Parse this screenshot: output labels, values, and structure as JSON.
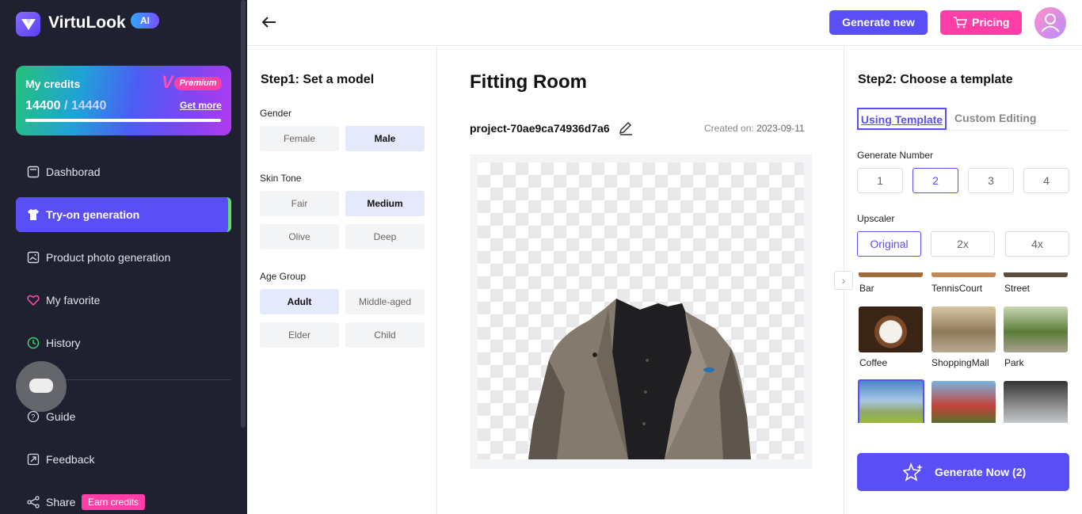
{
  "app": {
    "name": "VirtuLook",
    "badge": "AI"
  },
  "credits": {
    "title": "My credits",
    "used": "14400",
    "separator": " / ",
    "total": "14440",
    "get_more": "Get more",
    "premium": "Premium",
    "bar_fraction": 1.0
  },
  "nav": [
    {
      "label": "Dashborad",
      "icon": "dashboard-icon"
    },
    {
      "label": "Try-on generation",
      "icon": "shirt-icon",
      "active": true
    },
    {
      "label": "Product photo generation",
      "icon": "photo-icon"
    },
    {
      "label": "My favorite",
      "icon": "heart-icon"
    },
    {
      "label": "History",
      "icon": "clock-icon"
    },
    {
      "label": "Guide",
      "icon": "help-icon"
    },
    {
      "label": "Feedback",
      "icon": "feedback-icon"
    },
    {
      "label": "Share",
      "icon": "share-icon"
    }
  ],
  "share_badge": "Earn credits",
  "header": {
    "generate_new": "Generate new",
    "pricing": "Pricing"
  },
  "step1": {
    "title": "Step1: Set a model",
    "gender": {
      "label": "Gender",
      "options": [
        "Female",
        "Male"
      ],
      "selected": "Male"
    },
    "skin": {
      "label": "Skin Tone",
      "options": [
        "Fair",
        "Medium",
        "Olive",
        "Deep"
      ],
      "selected": "Medium"
    },
    "age": {
      "label": "Age Group",
      "options": [
        "Adult",
        "Middle-aged",
        "Elder",
        "Child"
      ],
      "selected": "Adult"
    }
  },
  "fitting": {
    "title": "Fitting Room",
    "project": "project-70ae9ca74936d7a6",
    "created_label": "Created on:",
    "created_date": "2023-09-11"
  },
  "step2": {
    "title": "Step2: Choose a template",
    "tabs": [
      "Using Template",
      "Custom Editing"
    ],
    "gen_number_label": "Generate Number",
    "gen_numbers": [
      "1",
      "2",
      "3",
      "4"
    ],
    "gen_selected": "2",
    "upscaler_label": "Upscaler",
    "upscalers": [
      "Original",
      "2x",
      "4x"
    ],
    "upscaler_selected": "Original",
    "templates_row1": [
      "Bar",
      "TennisCourt",
      "Street"
    ],
    "templates_row2": [
      "Coffee",
      "ShoppingMall",
      "Park"
    ],
    "generate_now": "Generate Now (2)"
  }
}
